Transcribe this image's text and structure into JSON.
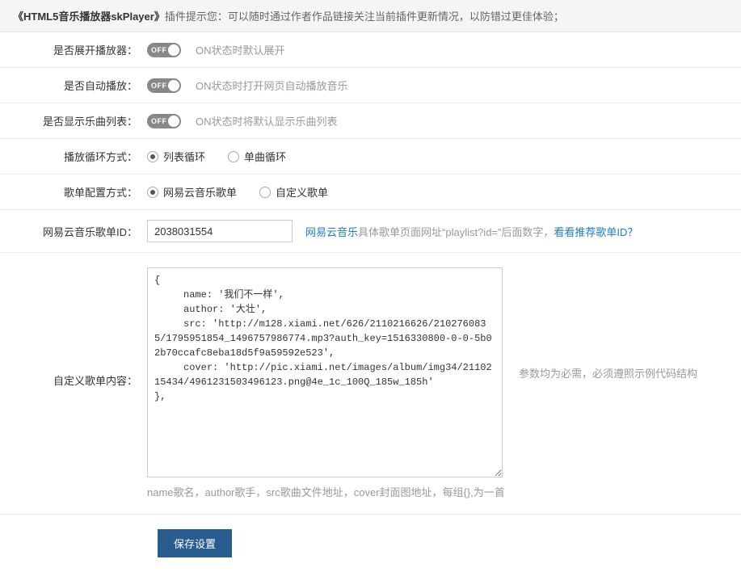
{
  "header": {
    "title_prefix": "《HTML5音乐播放器skPlayer》",
    "title_suffix": "插件提示您：可以随时通过作者作品链接关注当前插件更新情况，以防错过更佳体验；"
  },
  "rows": {
    "expand": {
      "label": "是否展开播放器：",
      "toggle_text": "OFF",
      "hint": "ON状态时默认展开"
    },
    "autoplay": {
      "label": "是否自动播放：",
      "toggle_text": "OFF",
      "hint": "ON状态时打开网页自动播放音乐"
    },
    "showlist": {
      "label": "是否显示乐曲列表：",
      "toggle_text": "OFF",
      "hint": "ON状态时将默认显示乐曲列表"
    },
    "loop": {
      "label": "播放循环方式：",
      "opt1": "列表循环",
      "opt2": "单曲循环"
    },
    "source": {
      "label": "歌单配置方式：",
      "opt1": "网易云音乐歌单",
      "opt2": "自定义歌单"
    },
    "playlist_id": {
      "label": "网易云音乐歌单ID：",
      "value": "2038031554",
      "link": "网易云音乐",
      "after": "具体歌单页面网址“playlist?id=”后面数字，",
      "link2": "看看推荐歌单ID？"
    },
    "custom": {
      "label": "自定义歌单内容：",
      "textarea": "{\n     name: '我们不一样',\n     author: '大壮',\n     src: 'http://m128.xiami.net/626/2110216626/2102760835/1795951854_1496757986774.mp3?auth_key=1516330800-0-0-5b02b70ccafc8eba18d5f9a59592e523',\n     cover: 'http://pic.xiami.net/images/album/img34/2110215434/4961231503496123.png@4e_1c_100Q_185w_185h'\n},",
      "right_hint": "参数均为必需，必须遵照示例代码结构",
      "below_hint": "name歌名，author歌手，src歌曲文件地址，cover封面图地址，每组{},为一首"
    }
  },
  "button": {
    "save": "保存设置"
  }
}
